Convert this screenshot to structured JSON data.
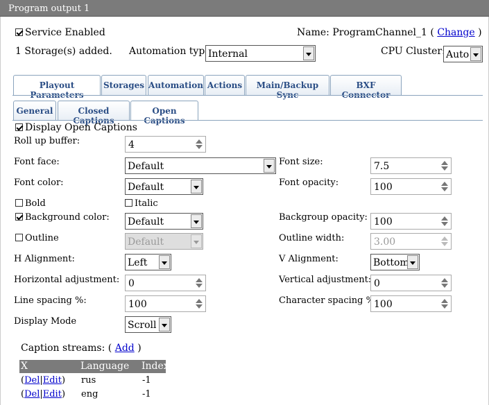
{
  "window": {
    "title": "Program output 1"
  },
  "header": {
    "service_enabled_label": "Service Enabled",
    "service_enabled_checked": true,
    "name_prefix": "Name:",
    "name_value": "ProgramChannel_1",
    "paren_open": "(",
    "paren_close": ")",
    "change_link": "Change",
    "storage_count_text": "1 Storage(s) added.",
    "automation_type_label": "Automation type:",
    "automation_type_value": "Internal",
    "cpu_cluster_label": "CPU Cluster:",
    "cpu_cluster_value": "Auto"
  },
  "main_tabs": [
    {
      "label": "Playout Parameters",
      "active": true
    },
    {
      "label": "Storages"
    },
    {
      "label": "Automation"
    },
    {
      "label": "Actions"
    },
    {
      "label": "Main/Backup Sync"
    },
    {
      "label": "BXF Connector"
    }
  ],
  "sub_tabs": [
    {
      "label": "General"
    },
    {
      "label": "Closed Captions"
    },
    {
      "label": "Open Captions",
      "active": true
    }
  ],
  "form": {
    "display_open_captions_label": "Display Open Captions",
    "display_open_captions_checked": true,
    "roll_up_buffer_label": "Roll up buffer:",
    "roll_up_buffer_value": "4",
    "font_face_label": "Font face:",
    "font_face_value": "Default",
    "font_size_label": "Font size:",
    "font_size_value": "7.5",
    "font_color_label": "Font color:",
    "font_color_value": "Default",
    "font_opacity_label": "Font opacity:",
    "font_opacity_value": "100",
    "bold_label": "Bold",
    "bold_checked": false,
    "italic_label": "Italic",
    "italic_checked": false,
    "background_color_label": "Background color:",
    "background_color_checked": true,
    "background_color_value": "Default",
    "background_opacity_label": "Backgroup opacity:",
    "background_opacity_value": "100",
    "outline_label": "Outline",
    "outline_checked": false,
    "outline_color_value": "Default",
    "outline_width_label": "Outline width:",
    "outline_width_value": "3.00",
    "h_alignment_label": "H Alignment:",
    "h_alignment_value": "Left",
    "v_alignment_label": "V Alignment:",
    "v_alignment_value": "Bottom",
    "horizontal_adjustment_label": "Horizontal adjustment:",
    "horizontal_adjustment_value": "0",
    "vertical_adjustment_label": "Vertical adjustment:",
    "vertical_adjustment_value": "0",
    "line_spacing_label": "Line spacing %:",
    "line_spacing_value": "100",
    "character_spacing_label": "Character spacing %:",
    "character_spacing_value": "100",
    "display_mode_label": "Display Mode",
    "display_mode_value": "Scroll"
  },
  "caption_streams": {
    "label": "Caption streams:",
    "add_link": "Add",
    "paren_open": "(",
    "paren_close": ")",
    "columns": [
      "X",
      "Language",
      "Index"
    ],
    "rows": [
      {
        "open": "(",
        "del": "Del",
        "sep": "|",
        "edit": "Edit",
        "close": ")",
        "language": "rus",
        "index": "-1"
      },
      {
        "open": "(",
        "del": "Del",
        "sep": "|",
        "edit": "Edit",
        "close": ")",
        "language": "eng",
        "index": "-1"
      }
    ]
  },
  "colors": {
    "titlebar": "#7b7b7b",
    "tab_text": "#2a4d85",
    "tab_border": "#8aa3bd",
    "link": "#0000cc"
  }
}
